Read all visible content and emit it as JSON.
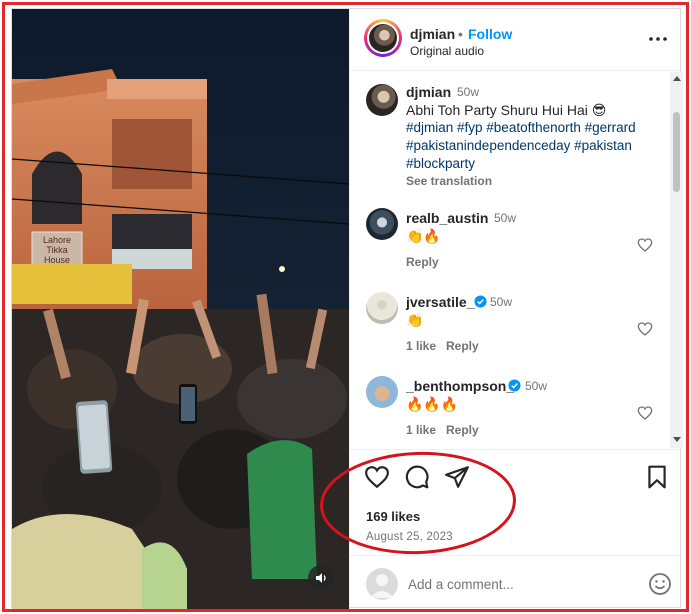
{
  "header": {
    "username": "djmian",
    "separator": "•",
    "follow_label": "Follow",
    "audio": "Original audio"
  },
  "media": {
    "sign_line1": "Lahore",
    "sign_line2": "Tikka",
    "sign_line3": "House"
  },
  "caption": {
    "username": "djmian",
    "time": "50w",
    "text": "Abhi Toh Party Shuru Hui Hai 😎",
    "hashtags": "#djmian #fyp #beatofthenorth #gerrard #pakistanindependenceday #pakistan #blockparty",
    "see_translation": "See translation"
  },
  "comments": [
    {
      "username": "realb_austin",
      "time": "50w",
      "text": "👏🔥",
      "likes_label": "",
      "reply_label": "Reply",
      "verified": false
    },
    {
      "username": "jversatile_",
      "time": "50w",
      "text": "👏",
      "likes_label": "1 like",
      "reply_label": "Reply",
      "verified": true
    },
    {
      "username": "_benthompson_",
      "time": "50w",
      "text": "🔥🔥🔥",
      "likes_label": "1 like",
      "reply_label": "Reply",
      "verified": true
    }
  ],
  "stats": {
    "likes": "169 likes",
    "date": "August 25, 2023"
  },
  "comment_box": {
    "placeholder": "Add a comment..."
  },
  "colors": {
    "link": "#0095f6",
    "hashtag": "#00376b",
    "annotation": "#d4141c",
    "verified": "#0095f6"
  }
}
